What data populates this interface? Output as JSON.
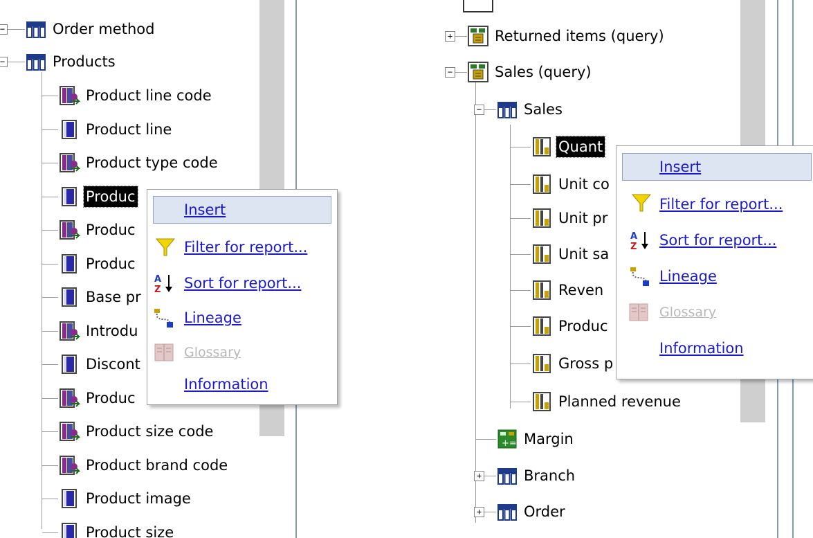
{
  "left": {
    "tree": [
      {
        "label": "Order method",
        "icon": "query-subject-icon",
        "toggle": "−"
      },
      {
        "label": "Products",
        "icon": "query-subject-icon",
        "toggle": "−"
      },
      {
        "label": "Product line code",
        "icon": "identifier-icon"
      },
      {
        "label": "Product line",
        "icon": "attribute-icon"
      },
      {
        "label": "Product type code",
        "icon": "identifier-icon"
      },
      {
        "label": "Produc",
        "icon": "attribute-icon",
        "selected": true
      },
      {
        "label": "Produc",
        "icon": "identifier-icon"
      },
      {
        "label": "Produc",
        "icon": "attribute-icon"
      },
      {
        "label": "Base pr",
        "icon": "attribute-icon"
      },
      {
        "label": "Introdu",
        "icon": "identifier-icon"
      },
      {
        "label": "Discont",
        "icon": "attribute-icon"
      },
      {
        "label": "Produc",
        "icon": "identifier-icon"
      },
      {
        "label": "Product size code",
        "icon": "identifier-icon"
      },
      {
        "label": "Product brand code",
        "icon": "identifier-icon"
      },
      {
        "label": "Product image",
        "icon": "attribute-icon"
      },
      {
        "label": "Product size",
        "icon": "attribute-icon"
      }
    ],
    "menu": [
      {
        "label": "Insert",
        "icon": "",
        "hover": true
      },
      {
        "label": "Filter for report...",
        "icon": "filter-icon"
      },
      {
        "label": "Sort for report...",
        "icon": "sort-icon"
      },
      {
        "label": "Lineage",
        "icon": "lineage-icon"
      },
      {
        "label": "Glossary",
        "icon": "glossary-icon",
        "disabled": true
      },
      {
        "label": "Information",
        "icon": ""
      }
    ]
  },
  "right": {
    "tree": [
      {
        "label": "Returned items (query)",
        "icon": "query-icon",
        "toggle": "+"
      },
      {
        "label": "Sales (query)",
        "icon": "query-icon",
        "toggle": "−"
      },
      {
        "label": "Sales",
        "icon": "query-subject-icon",
        "toggle": "−"
      },
      {
        "label": "Quant",
        "icon": "measure-icon",
        "selected": true
      },
      {
        "label": "Unit co",
        "icon": "measure-icon"
      },
      {
        "label": "Unit pr",
        "icon": "measure-icon"
      },
      {
        "label": "Unit sa",
        "icon": "measure-icon"
      },
      {
        "label": "Reven",
        "icon": "measure-icon"
      },
      {
        "label": "Produc",
        "icon": "measure-icon"
      },
      {
        "label": "Gross p",
        "icon": "measure-icon"
      },
      {
        "label": "Planned revenue",
        "icon": "measure-icon"
      },
      {
        "label": "Margin",
        "icon": "calculation-icon"
      },
      {
        "label": "Branch",
        "icon": "query-subject-icon",
        "toggle": "+"
      },
      {
        "label": "Order",
        "icon": "query-subject-icon",
        "toggle": "+"
      }
    ],
    "menu": [
      {
        "label": "Insert",
        "icon": "",
        "hover": true
      },
      {
        "label": "Filter for report...",
        "icon": "filter-icon"
      },
      {
        "label": "Sort for report...",
        "icon": "sort-icon"
      },
      {
        "label": "Lineage",
        "icon": "lineage-icon"
      },
      {
        "label": "Glossary",
        "icon": "glossary-icon",
        "disabled": true
      },
      {
        "label": "Information",
        "icon": ""
      }
    ]
  },
  "colors": {
    "link": "#1a1acc",
    "disabled": "#b8b8b8",
    "hover_bg": "#dde4f2",
    "scrollbar": "#cfcfcf",
    "divider": "#7f9db9"
  }
}
